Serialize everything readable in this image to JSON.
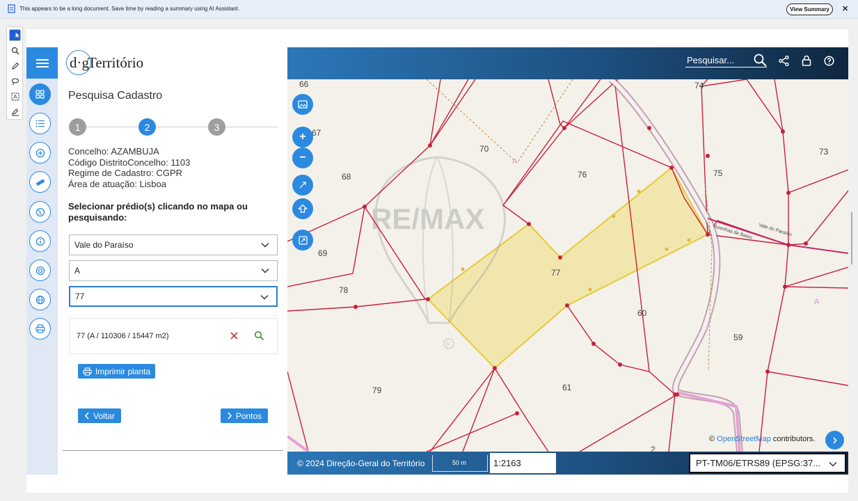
{
  "ai_bar": {
    "message": "This appears to be a long document. Save time by reading a summary using AI Assistant.",
    "button": "View Summary"
  },
  "app": {
    "logo_prefix": "d·g",
    "logo_text": "Território"
  },
  "panel": {
    "title": "Pesquisa Cadastro",
    "steps": [
      "1",
      "2",
      "3"
    ],
    "info": {
      "concelho": "Concelho: AZAMBUJA",
      "codigo": "Código DistritoConcelho: 1103",
      "regime": "Regime de Cadastro: CGPR",
      "area": "Área de atuação: Lisboa"
    },
    "select_label": "Selecionar prédio(s) clicando no mapa ou pesquisando:",
    "selects": [
      "Vale do Paraíso",
      "A",
      "77"
    ],
    "result": "77 (A / 110306 / 15447 m2)",
    "print_label": "Imprimir planta",
    "back_label": "Voltar",
    "next_label": "Pontos"
  },
  "map": {
    "search_placeholder": "Pesquisar...",
    "parcels": [
      "66",
      "67",
      "70",
      "74",
      "73",
      "68",
      "76",
      "75",
      "69",
      "77",
      "78",
      "60",
      "59",
      "79",
      "61",
      "2"
    ],
    "section_labels": [
      "A",
      "A"
    ],
    "street_labels": [
      "Vale do Paraíso",
      "Azenhas de Baixo"
    ],
    "watermark": "RE/MAX",
    "watermark_mark": "R",
    "attribution_prefix": "©",
    "attribution_link": "OpenStreetMap",
    "attribution_suffix": "contributors.",
    "copyright": "© 2024 Direção-Geral do Território",
    "scalebar": "50 m",
    "scale": "1:2163",
    "crs": "PT-TM06/ETRS89 (EPSG:37..."
  },
  "colors": {
    "accent": "#2b8ae0",
    "parcel_line": "#c8203a",
    "highlight": "#f0e39a"
  }
}
